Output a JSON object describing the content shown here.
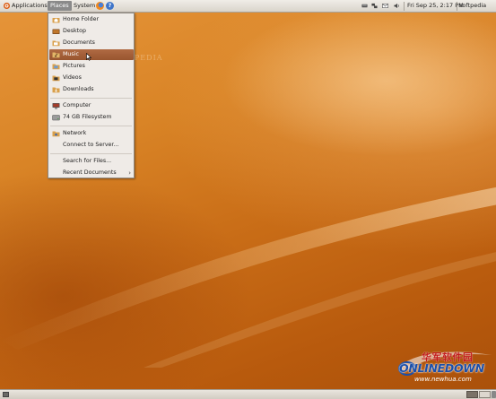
{
  "top_panel": {
    "applications_label": "Applications",
    "places_label": "Places",
    "system_label": "System",
    "clock": "Fri Sep 25,  2:17 PM",
    "user": "softpedia",
    "icons": [
      "firefox-icon",
      "help-icon",
      "keyboard-icon",
      "network-icon",
      "mail-icon",
      "volume-icon"
    ]
  },
  "places_menu": {
    "items": [
      {
        "label": "Home Folder",
        "icon": "home-folder-icon"
      },
      {
        "label": "Desktop",
        "icon": "desktop-icon"
      },
      {
        "label": "Documents",
        "icon": "folder-icon"
      },
      {
        "label": "Music",
        "icon": "music-folder-icon"
      },
      {
        "label": "Pictures",
        "icon": "pictures-folder-icon"
      },
      {
        "label": "Videos",
        "icon": "videos-folder-icon"
      },
      {
        "label": "Downloads",
        "icon": "downloads-folder-icon"
      },
      {
        "label": "Computer",
        "icon": "computer-icon"
      },
      {
        "label": "74 GB Filesystem",
        "icon": "drive-icon"
      },
      {
        "label": "Network",
        "icon": "network-icon"
      },
      {
        "label": "Connect to Server...",
        "icon": ""
      },
      {
        "label": "Search for Files...",
        "icon": ""
      },
      {
        "label": "Recent Documents",
        "icon": ""
      }
    ],
    "highlighted": "Music",
    "submenu_arrow": "›"
  },
  "watermark": "SOFTPEDIA",
  "site_logo": {
    "chinese": "华军软件园",
    "english": "ONLINEDOWN",
    "url": "www.newhua.com"
  },
  "colors": {
    "menu_highlight": "#a55f39",
    "wallpaper": "#c36a15",
    "panel": "#e3dfd8"
  }
}
